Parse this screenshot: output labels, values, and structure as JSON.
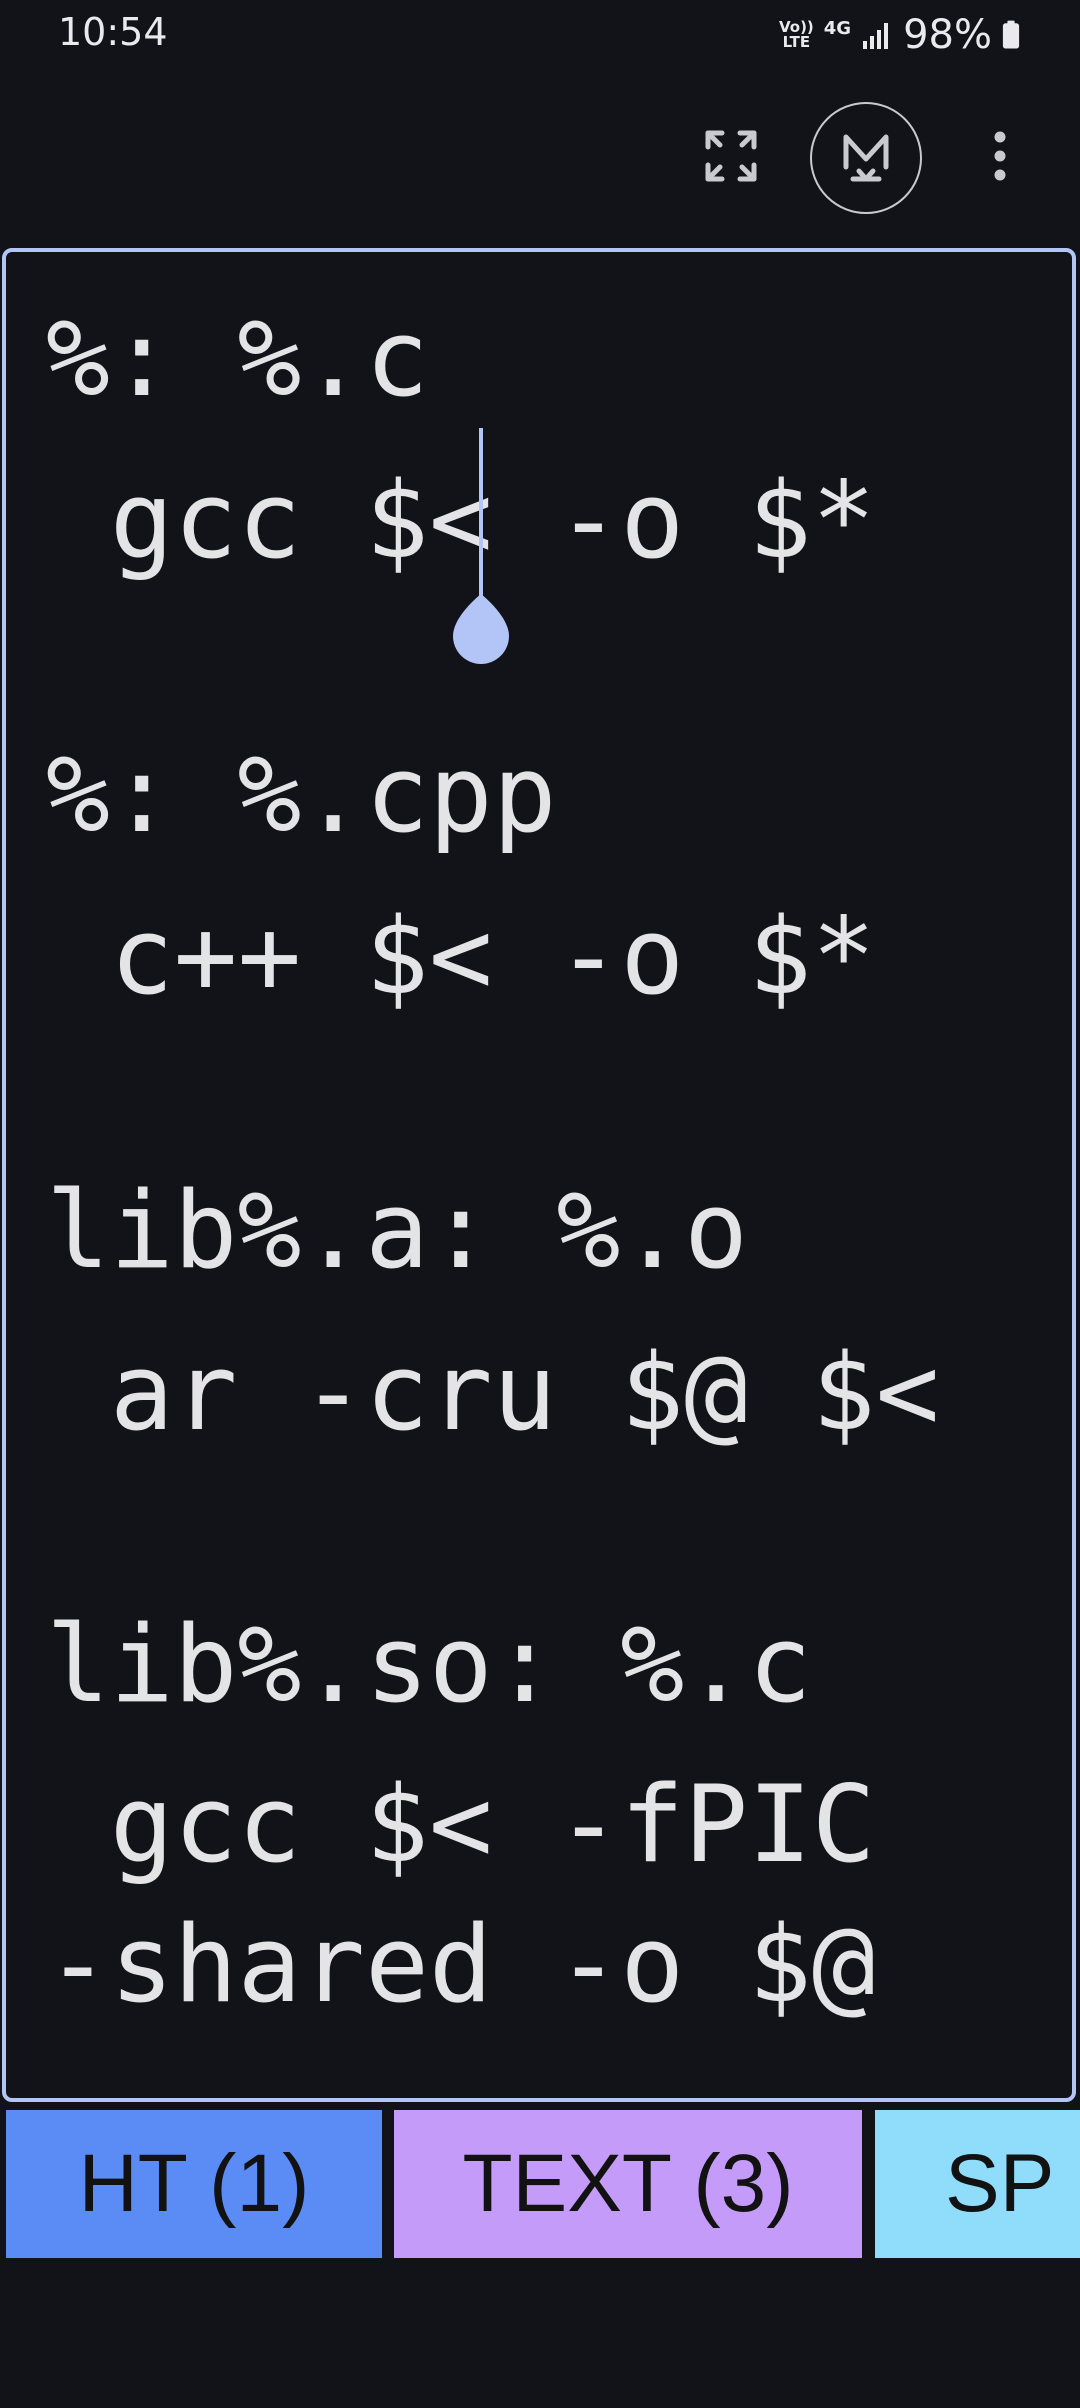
{
  "status_bar": {
    "time": "10:54",
    "volte_top": "Vo))",
    "volte_bottom": "LTE",
    "network": "4G",
    "battery": "98%"
  },
  "toolbar": {
    "fullscreen_icon": "fullscreen-icon",
    "markdown_icon": "markdown-icon",
    "more_icon": "more-vert-icon"
  },
  "editor": {
    "lines": [
      "%: %.c",
      " gcc $< -o $*",
      "%: %.cpp",
      " c++ $< -o $*",
      "lib%.a: %.o",
      " ar -cru $@ $<",
      "lib%.so: %.c",
      " gcc $< -fPIC",
      "-shared -o $@"
    ],
    "accent_color": "#b3c5f7"
  },
  "chips": [
    {
      "label": "HT (1)",
      "color": "#5b8cf6"
    },
    {
      "label": "TEXT (3)",
      "color": "#c49bf8"
    },
    {
      "label": "SP (",
      "color": "#8fdcfb"
    }
  ]
}
